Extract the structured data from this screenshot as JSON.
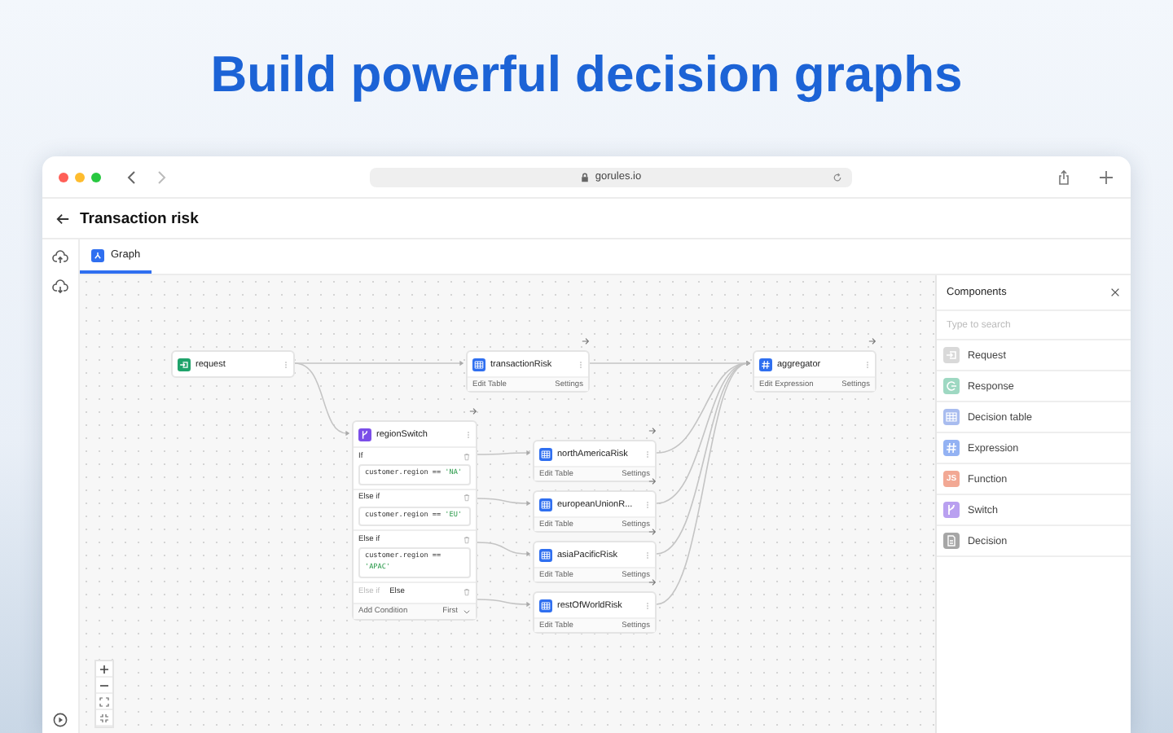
{
  "headline": "Build powerful decision graphs",
  "browser": {
    "url": "gorules.io"
  },
  "page": {
    "title": "Transaction risk"
  },
  "tabs": [
    {
      "label": "Graph",
      "selected": true
    }
  ],
  "nodes": [
    {
      "kind": "input",
      "label": "request"
    },
    {
      "kind": "table",
      "label": "transactionRisk",
      "actions": [
        "Edit Table",
        "Settings"
      ]
    },
    {
      "kind": "expression",
      "label": "aggregator",
      "actions": [
        "Edit Expression",
        "Settings"
      ]
    },
    {
      "kind": "switch",
      "label": "regionSwitch",
      "conditions": [
        {
          "kind": "expression",
          "label": "If",
          "code": "customer.region == ",
          "literal": "'NA'"
        },
        {
          "kind": "expression",
          "label": "Else if",
          "code": "customer.region == ",
          "literal": "'EU'"
        },
        {
          "kind": "expression",
          "label": "Else if",
          "code": "customer.region ==",
          "literal": "'APAC'"
        },
        {
          "kind": "else",
          "label": "Else if",
          "value": "Else"
        }
      ],
      "add_label": "Add Condition",
      "mode": "First"
    },
    {
      "kind": "table",
      "label": "northAmericaRisk",
      "actions": [
        "Edit Table",
        "Settings"
      ]
    },
    {
      "kind": "table",
      "label": "europeanUnionR...",
      "actions": [
        "Edit Table",
        "Settings"
      ]
    },
    {
      "kind": "table",
      "label": "asiaPacificRisk",
      "actions": [
        "Edit Table",
        "Settings"
      ]
    },
    {
      "kind": "table",
      "label": "restOfWorldRisk",
      "actions": [
        "Edit Table",
        "Settings"
      ]
    }
  ],
  "components": {
    "title": "Components",
    "search": {
      "placeholder": "Type to search"
    },
    "items": [
      {
        "label": "Request",
        "kind": "input",
        "color": "#d9d9d9"
      },
      {
        "label": "Response",
        "kind": "output",
        "color": "#9ed8c2"
      },
      {
        "label": "Decision table",
        "kind": "table",
        "color": "#a8bcef"
      },
      {
        "label": "Expression",
        "kind": "expression",
        "color": "#93b2f3"
      },
      {
        "label": "Function",
        "kind": "function",
        "color": "#f2a894",
        "icon_text": "JS"
      },
      {
        "label": "Switch",
        "kind": "switch",
        "color": "#b9a0f0"
      },
      {
        "label": "Decision",
        "kind": "decision",
        "color": "#a6a6a6"
      }
    ]
  }
}
